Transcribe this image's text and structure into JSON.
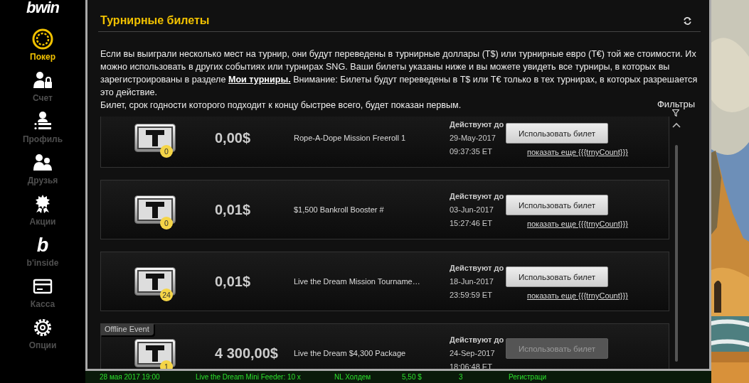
{
  "logo": "bwin",
  "sidebar": {
    "items": [
      {
        "kind": "poker",
        "label": "Покер",
        "selected": true
      },
      {
        "kind": "account",
        "label": "Счет",
        "selected": false
      },
      {
        "kind": "profile",
        "label": "Профиль",
        "selected": false
      },
      {
        "kind": "friends",
        "label": "Друзья",
        "selected": false
      },
      {
        "kind": "promotions",
        "label": "Акции",
        "selected": false
      },
      {
        "kind": "binside",
        "glyph": "b",
        "label": "b'inside",
        "selected": false
      },
      {
        "kind": "cashier",
        "label": "Касса",
        "selected": false
      },
      {
        "kind": "options",
        "label": "Опции",
        "selected": false
      }
    ]
  },
  "dialog": {
    "title": "Турнирные билеты",
    "description": {
      "before": "Если вы выиграли несколько мест на турнир, они будут переведены в турнирные доллары (T$) или турнирные евро (T€) той же стоимости. Их можно использовать в других событиях или турнирах SNG. Ваши билеты указаны ниже и вы можете увидеть все турниры, в которых вы зарегистроированы в разделе",
      "link": "Мои турниры.",
      "after": "Внимание: Билеты будут переведены в T$ или T€ только в тех турнирах, в которых разрешается это действие."
    },
    "note": "Билет, срок годности которого подходит к концу быстрее всего, будет показан первым.",
    "filters": "Фильтры",
    "tickets": [
      {
        "count": "0",
        "amount": "0,00$",
        "name": "Rope-A-Dope Mission Freeroll 1",
        "valid_label": "Действуют до",
        "date": "29-May-2017",
        "time": "09:37:35 ET",
        "button": "Использовать билет",
        "disabled": false,
        "more": "показать еще {{{trnyCount}}}"
      },
      {
        "count": "0",
        "amount": "0,01$",
        "name": "$1,500 Bankroll Booster #",
        "valid_label": "Действуют до",
        "date": "03-Jun-2017",
        "time": "15:27:46 ET",
        "button": "Использовать билет",
        "disabled": false,
        "more": "показать еще {{{trnyCount}}}"
      },
      {
        "count": "24",
        "amount": "0,01$",
        "name": "Live the Dream Mission Tourname…",
        "valid_label": "Действуют до",
        "date": "18-Jun-2017",
        "time": "23:59:59 ET",
        "button": "Использовать билет",
        "disabled": false,
        "more": "показать еще {{{trnyCount}}}"
      },
      {
        "tag": "Offline Event",
        "count": "1",
        "amount": "4 300,00$",
        "name": "Live the Dream $4,300 Package",
        "valid_label": "Действуют до",
        "date": "24-Sep-2017",
        "time": "18:06:48 ET",
        "button": "Использовать билет",
        "disabled": true
      }
    ]
  },
  "background_row": [
    "28 мая 2017 19:00",
    "Live the Dream Mini Feeder: 10 x",
    "NL Холдем",
    "5,50 $",
    "3",
    "Регистраци"
  ]
}
